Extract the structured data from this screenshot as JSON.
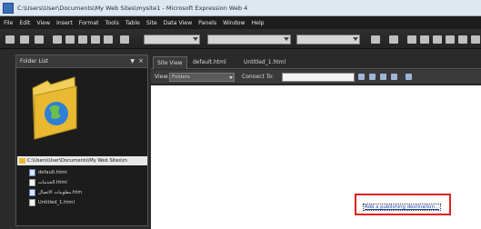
{
  "window": {
    "title": "C:\\Users\\User\\Documents\\My Web Sites\\mysite1 - Microsoft Expression Web 4"
  },
  "menubar": {
    "items": [
      "File",
      "Edit",
      "View",
      "Insert",
      "Format",
      "Tools",
      "Table",
      "Site",
      "Data View",
      "Panels",
      "Window",
      "Help"
    ]
  },
  "folder_panel": {
    "title": "Folder List",
    "pin_glyph": "▼",
    "close_glyph": "×",
    "root_path": "C:\\Users\\User\\Documents\\My Web Sites\\m",
    "files": [
      {
        "name": "default.html",
        "icon": "html-file-icon"
      },
      {
        "name": "الخدمات.html",
        "icon": "html-file-icon"
      },
      {
        "name": "معلومات الاتصال.htm",
        "icon": "html-file-icon"
      },
      {
        "name": "Untitled_1.html",
        "icon": "html-file-icon"
      }
    ]
  },
  "editor": {
    "tabs": [
      "Site View",
      "default.html",
      "Untitled_1.html"
    ],
    "view_label": "View:",
    "view_value": "Folders",
    "connect_label": "Connect To:",
    "publish_link": "Add a publishing destination..."
  },
  "colors": {
    "highlight": "#e02020",
    "link": "#1b3fa5"
  }
}
